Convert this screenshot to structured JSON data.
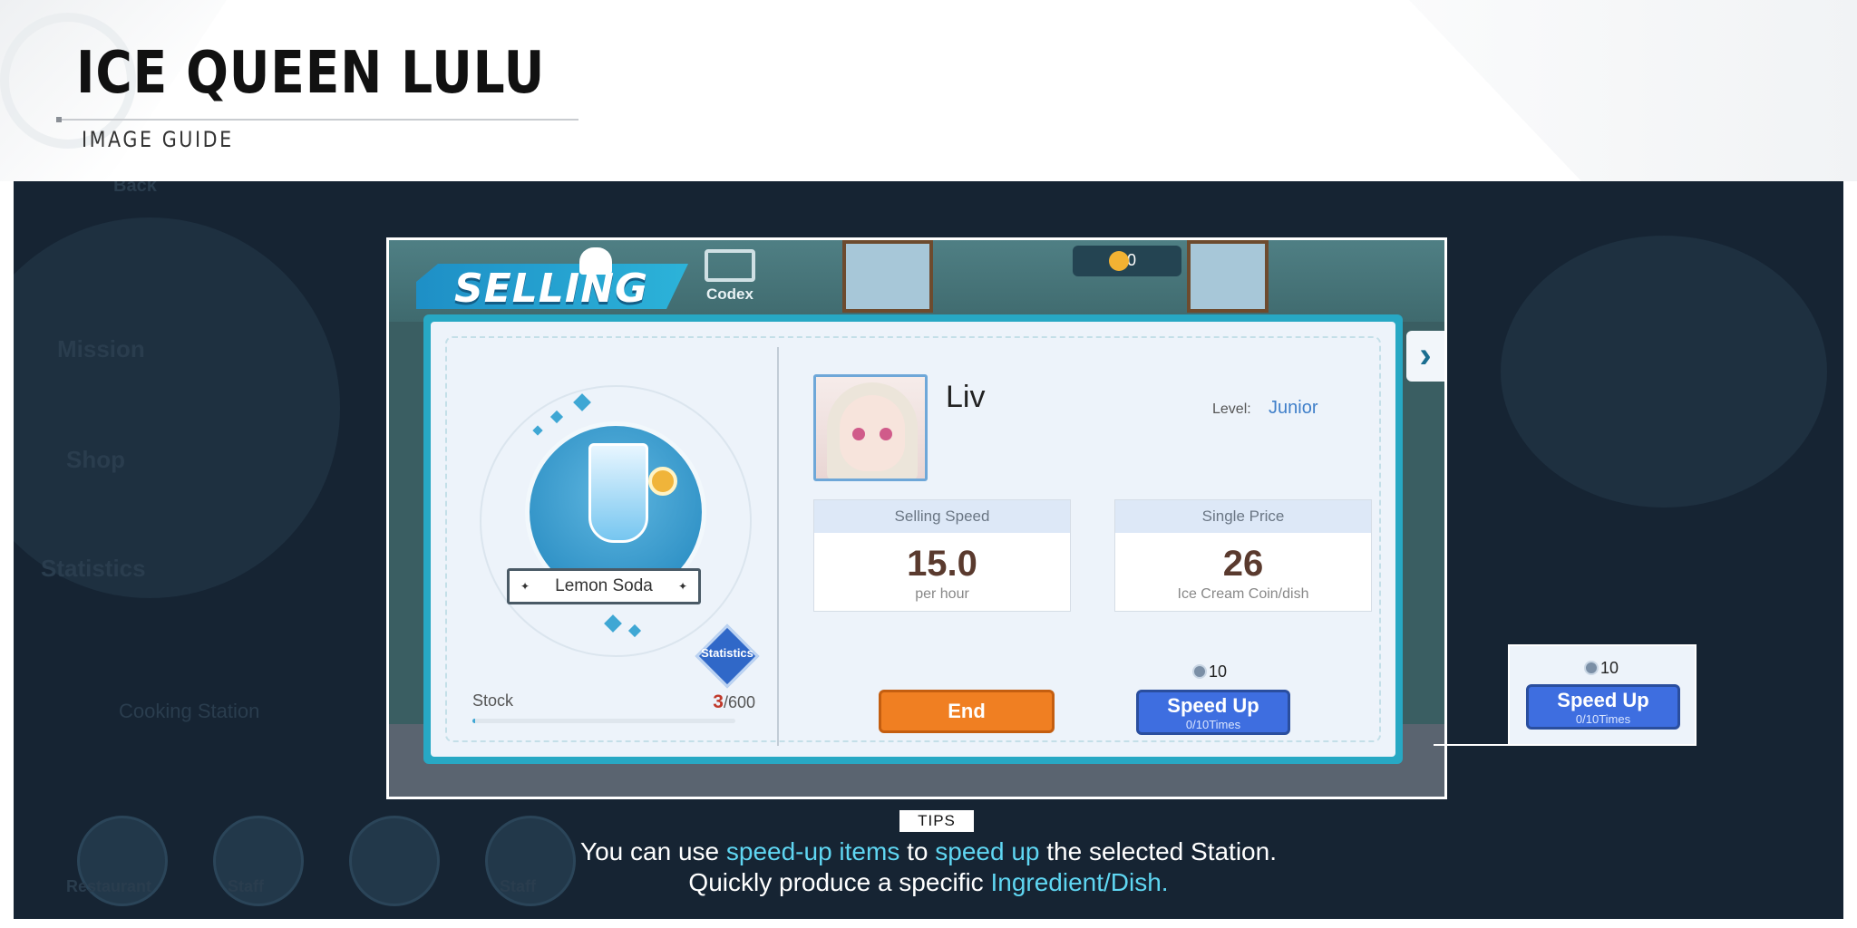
{
  "header": {
    "title": "ICE QUEEN LULU",
    "subtitle": "IMAGE GUIDE"
  },
  "background_ghost_labels": [
    "Back",
    "Mission",
    "Shop",
    "Statistics",
    "Cooking Station",
    "Restaurant",
    "Staff",
    "Staff"
  ],
  "game": {
    "selling_title": "SELLING",
    "codex_label": "Codex",
    "coin_count": "0",
    "next_icon": "chevron-right-icon",
    "dish": {
      "name": "Lemon Soda",
      "statistics_label": "Statistics",
      "stock_label": "Stock",
      "stock_current": "3",
      "stock_max": "/600",
      "stock_fraction": 0.005
    },
    "character": {
      "name": "Liv",
      "level_label": "Level:",
      "level_value": "Junior"
    },
    "selling_speed": {
      "label": "Selling Speed",
      "value": "15.0",
      "unit": "per hour"
    },
    "single_price": {
      "label": "Single Price",
      "value": "26",
      "unit": "Ice Cream Coin/dish"
    },
    "end_button": "End",
    "speed_up": {
      "cost": "10",
      "label": "Speed Up",
      "times": "0/10Times"
    }
  },
  "callout": {
    "cost": "10",
    "label": "Speed Up",
    "times": "0/10Times"
  },
  "tips": {
    "badge": "TIPS",
    "line1": [
      {
        "text": "You can use ",
        "hl": false
      },
      {
        "text": "speed-up items",
        "hl": true
      },
      {
        "text": " to ",
        "hl": false
      },
      {
        "text": "speed up",
        "hl": true
      },
      {
        "text": " the selected Station.",
        "hl": false
      }
    ],
    "line2": [
      {
        "text": "Quickly produce a specific ",
        "hl": false
      },
      {
        "text": "Ingredient/Dish.",
        "hl": true
      }
    ]
  },
  "colors": {
    "stage_bg": "#162433",
    "highlight": "#5fd6f2",
    "end_button": "#f07f22",
    "speed_button": "#3e6ee0"
  }
}
